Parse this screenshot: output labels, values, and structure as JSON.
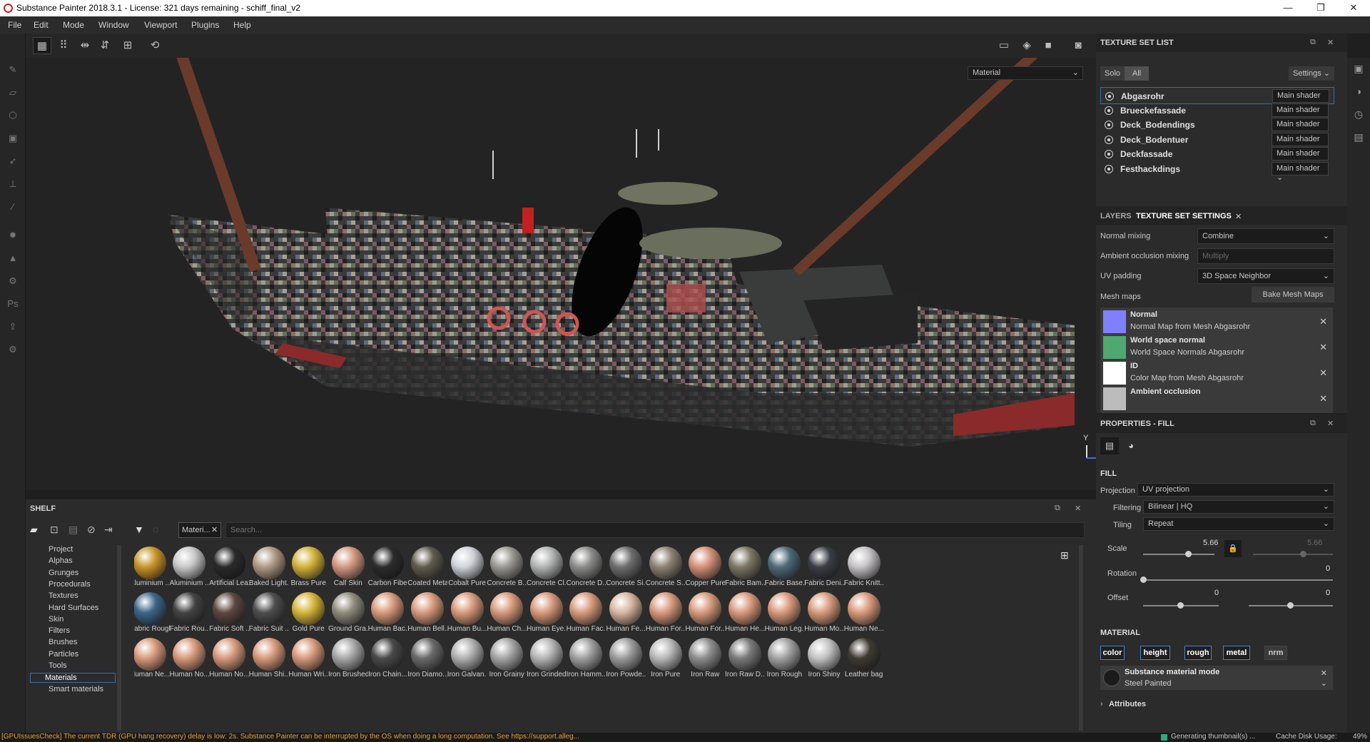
{
  "window": {
    "title": "Substance Painter 2018.3.1 - License: 321 days remaining - schiff_final_v2",
    "controls": [
      "—",
      "❐",
      "✕"
    ]
  },
  "menu": [
    "File",
    "Edit",
    "Mode",
    "Window",
    "Viewport",
    "Plugins",
    "Help"
  ],
  "viewport": {
    "mode_select": "Material",
    "axis_y": "Y",
    "axis_z": "Z"
  },
  "texture_set_list": {
    "title": "TEXTURE SET LIST",
    "solo": "Solo",
    "all": "All",
    "settings": "Settings",
    "items": [
      {
        "name": "Abgasrohr",
        "shader": "Main shader"
      },
      {
        "name": "Brueckefassade",
        "shader": "Main shader"
      },
      {
        "name": "Deck_Bodendings",
        "shader": "Main shader"
      },
      {
        "name": "Deck_Bodentuer",
        "shader": "Main shader"
      },
      {
        "name": "Deckfassade",
        "shader": "Main shader"
      },
      {
        "name": "Festhackdings",
        "shader": "Main shader"
      }
    ]
  },
  "texture_set_settings": {
    "tab_layers": "LAYERS",
    "tab_settings": "TEXTURE SET SETTINGS",
    "normal_mixing_label": "Normal mixing",
    "normal_mixing_value": "Combine",
    "ao_mixing_label": "Ambient occlusion mixing",
    "ao_mixing_value": "Multiply",
    "uv_padding_label": "UV padding",
    "uv_padding_value": "3D Space Neighbor",
    "mesh_maps_label": "Mesh maps",
    "bake_button": "Bake Mesh Maps",
    "mesh_maps": [
      {
        "title": "Normal",
        "subtitle": "Normal Map from Mesh Abgasrohr",
        "color": "#8080ff"
      },
      {
        "title": "World space normal",
        "subtitle": "World Space Normals Abgasrohr",
        "color": "#4fa870"
      },
      {
        "title": "ID",
        "subtitle": "Color Map from Mesh Abgasrohr",
        "color": "#ffffff"
      },
      {
        "title": "Ambient occlusion",
        "subtitle": "",
        "color": "#bcbcbc"
      }
    ]
  },
  "properties": {
    "title": "PROPERTIES - FILL",
    "fill_section": "FILL",
    "projection_label": "Projection",
    "projection_value": "UV projection",
    "filtering_label": "Filtering",
    "filtering_value": "Bilinear | HQ",
    "tiling_label": "Tiling",
    "tiling_value": "Repeat",
    "scale_label": "Scale",
    "scale_value": "5.66",
    "scale_value_locked": "5.66",
    "rotation_label": "Rotation",
    "rotation_value": "0",
    "offset_label": "Offset",
    "offset_x": "0",
    "offset_y": "0",
    "material_section": "MATERIAL",
    "channels": [
      "color",
      "height",
      "rough",
      "metal",
      "nrm"
    ],
    "material_mode_title": "Substance material mode",
    "material_mode_value": "Steel Painted",
    "attributes": "Attributes"
  },
  "shelf": {
    "title": "SHELF",
    "filter_tag": "Materi...",
    "search_placeholder": "Search...",
    "categories": [
      "Project",
      "Alphas",
      "Grunges",
      "Procedurals",
      "Textures",
      "Hard Surfaces",
      "Skin",
      "Filters",
      "Brushes",
      "Particles",
      "Tools",
      "Materials",
      "Smart materials"
    ],
    "selected_category": "Materials",
    "materials": [
      {
        "name": "Aluminium ...",
        "color": "#c9952a"
      },
      {
        "name": "Aluminium ...",
        "color": "#c8c8c8"
      },
      {
        "name": "Artificial Lea...",
        "color": "#2a2a2a"
      },
      {
        "name": "Baked Light...",
        "color": "#b09a85"
      },
      {
        "name": "Brass Pure",
        "color": "#d2b23a"
      },
      {
        "name": "Calf Skin",
        "color": "#d39a82"
      },
      {
        "name": "Carbon Fiber",
        "color": "#2c2c2c"
      },
      {
        "name": "Coated Metal",
        "color": "#5f5b4d"
      },
      {
        "name": "Cobalt Pure",
        "color": "#d0d3d8"
      },
      {
        "name": "Concrete B...",
        "color": "#9a9893"
      },
      {
        "name": "Concrete Cl...",
        "color": "#b3b4b4"
      },
      {
        "name": "Concrete D...",
        "color": "#8c8c8b"
      },
      {
        "name": "Concrete Si...",
        "color": "#6e6e6e"
      },
      {
        "name": "Concrete S...",
        "color": "#8e8275"
      },
      {
        "name": "Copper Pure",
        "color": "#d4917a"
      },
      {
        "name": "Fabric Bam...",
        "color": "#7d7766"
      },
      {
        "name": "Fabric Base...",
        "color": "#4f6a79"
      },
      {
        "name": "Fabric Deni...",
        "color": "#3b3e45"
      },
      {
        "name": "Fabric Knitt...",
        "color": "#c5c3c6"
      },
      {
        "name": "Fabric Rough",
        "color": "#3d6588"
      },
      {
        "name": "Fabric Rou...",
        "color": "#434343"
      },
      {
        "name": "Fabric Soft ...",
        "color": "#5d4740"
      },
      {
        "name": "Fabric Suit ...",
        "color": "#4e4e4e"
      },
      {
        "name": "Gold Pure",
        "color": "#d6b43a"
      },
      {
        "name": "Ground Gra...",
        "color": "#8f8b7c"
      },
      {
        "name": "Human Bac...",
        "color": "#d89a7c"
      },
      {
        "name": "Human Bell...",
        "color": "#d89a7c"
      },
      {
        "name": "Human Bu...",
        "color": "#d89a7c"
      },
      {
        "name": "Human Ch...",
        "color": "#d89a7c"
      },
      {
        "name": "Human Eye...",
        "color": "#d89a7c"
      },
      {
        "name": "Human Fac...",
        "color": "#d89a7c"
      },
      {
        "name": "Human Fe...",
        "color": "#d8b6a0"
      },
      {
        "name": "Human For...",
        "color": "#d89a7c"
      },
      {
        "name": "Human For...",
        "color": "#d89a7c"
      },
      {
        "name": "Human He...",
        "color": "#d89a7c"
      },
      {
        "name": "Human Leg...",
        "color": "#d89a7c"
      },
      {
        "name": "Human Mo...",
        "color": "#d89a7c"
      },
      {
        "name": "Human Ne...",
        "color": "#d89a7c"
      },
      {
        "name": "Human Ne...",
        "color": "#d89a7c"
      },
      {
        "name": "Human No...",
        "color": "#d89a7c"
      },
      {
        "name": "Human No...",
        "color": "#d89a7c"
      },
      {
        "name": "Human Shi...",
        "color": "#d89a7c"
      },
      {
        "name": "Human Wri...",
        "color": "#d89a7c"
      },
      {
        "name": "Iron Brushed",
        "color": "#a8a8a8"
      },
      {
        "name": "Iron Chain...",
        "color": "#4a4a4a"
      },
      {
        "name": "Iron Diamo...",
        "color": "#6a6a6a"
      },
      {
        "name": "Iron Galvan...",
        "color": "#b0b0b0"
      },
      {
        "name": "Iron Grainy",
        "color": "#a5a5a5"
      },
      {
        "name": "Iron Grinded",
        "color": "#b5b5b5"
      },
      {
        "name": "Iron Hamm...",
        "color": "#a0a0a0"
      },
      {
        "name": "Iron Powde...",
        "color": "#9c9c9c"
      },
      {
        "name": "Iron Pure",
        "color": "#b8b8b8"
      },
      {
        "name": "Iron Raw",
        "color": "#8e8e8e"
      },
      {
        "name": "Iron Raw D...",
        "color": "#7a7a7a"
      },
      {
        "name": "Iron Rough",
        "color": "#a2a2a2"
      },
      {
        "name": "Iron Shiny",
        "color": "#c2c2c2"
      },
      {
        "name": "Leather bag",
        "color": "#3f3a33"
      }
    ]
  },
  "status": {
    "warning": "[GPUIssuesCheck] The current TDR (GPU hang recovery) delay is low: 2s. Substance Painter can be interrupted by the OS when doing a long computation. See https://support.alleg...",
    "generating": "Generating thumbnail(s) ...",
    "cache_label": "Cache Disk Usage:",
    "cache_value": "49%"
  }
}
